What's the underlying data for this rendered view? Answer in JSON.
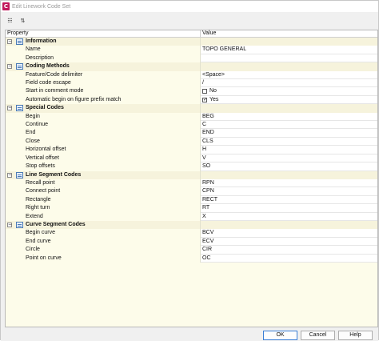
{
  "window": {
    "title": "Edit Linework Code Set",
    "icon_letter": "C"
  },
  "toolbar": {
    "buttons": [
      {
        "icon": "sort-categorized-icon"
      },
      {
        "icon": "sort-alphabetical-icon"
      }
    ]
  },
  "grid": {
    "header": {
      "property": "Property",
      "value": "Value"
    },
    "sections": [
      {
        "name": "Information",
        "items": [
          {
            "label": "Name",
            "value": "TOPO GENERAL"
          },
          {
            "label": "Description",
            "value": ""
          }
        ]
      },
      {
        "name": "Coding Methods",
        "items": [
          {
            "label": "Feature/Code delimiter",
            "value": "<Space>"
          },
          {
            "label": "Field code escape",
            "value": "/"
          },
          {
            "label": "Start in comment mode",
            "value": "No",
            "checkbox": false
          },
          {
            "label": "Automatic begin on figure prefix match",
            "value": "Yes",
            "checkbox": true
          }
        ]
      },
      {
        "name": "Special Codes",
        "items": [
          {
            "label": "Begin",
            "value": "BEG"
          },
          {
            "label": "Continue",
            "value": "C"
          },
          {
            "label": "End",
            "value": "END"
          },
          {
            "label": "Close",
            "value": "CLS"
          },
          {
            "label": "Horizontal offset",
            "value": "H"
          },
          {
            "label": "Vertical offset",
            "value": "V"
          },
          {
            "label": "Stop offsets",
            "value": "SO"
          }
        ]
      },
      {
        "name": "Line Segment Codes",
        "items": [
          {
            "label": "Recall point",
            "value": "RPN"
          },
          {
            "label": "Connect point",
            "value": "CPN"
          },
          {
            "label": "Rectangle",
            "value": "RECT"
          },
          {
            "label": "Right turn",
            "value": "RT"
          },
          {
            "label": "Extend",
            "value": "X"
          }
        ]
      },
      {
        "name": "Curve Segment Codes",
        "items": [
          {
            "label": "Begin curve",
            "value": "BCV"
          },
          {
            "label": "End curve",
            "value": "ECV"
          },
          {
            "label": "Circle",
            "value": "CIR"
          },
          {
            "label": "Point on curve",
            "value": "OC"
          }
        ]
      }
    ]
  },
  "footer": {
    "ok_label": "OK",
    "cancel_label": "Cancel",
    "help_label": "Help"
  },
  "colors": {
    "grid_background": "#fdfcea",
    "category_row": "#f6f3dc",
    "accent": "#c2185b"
  }
}
